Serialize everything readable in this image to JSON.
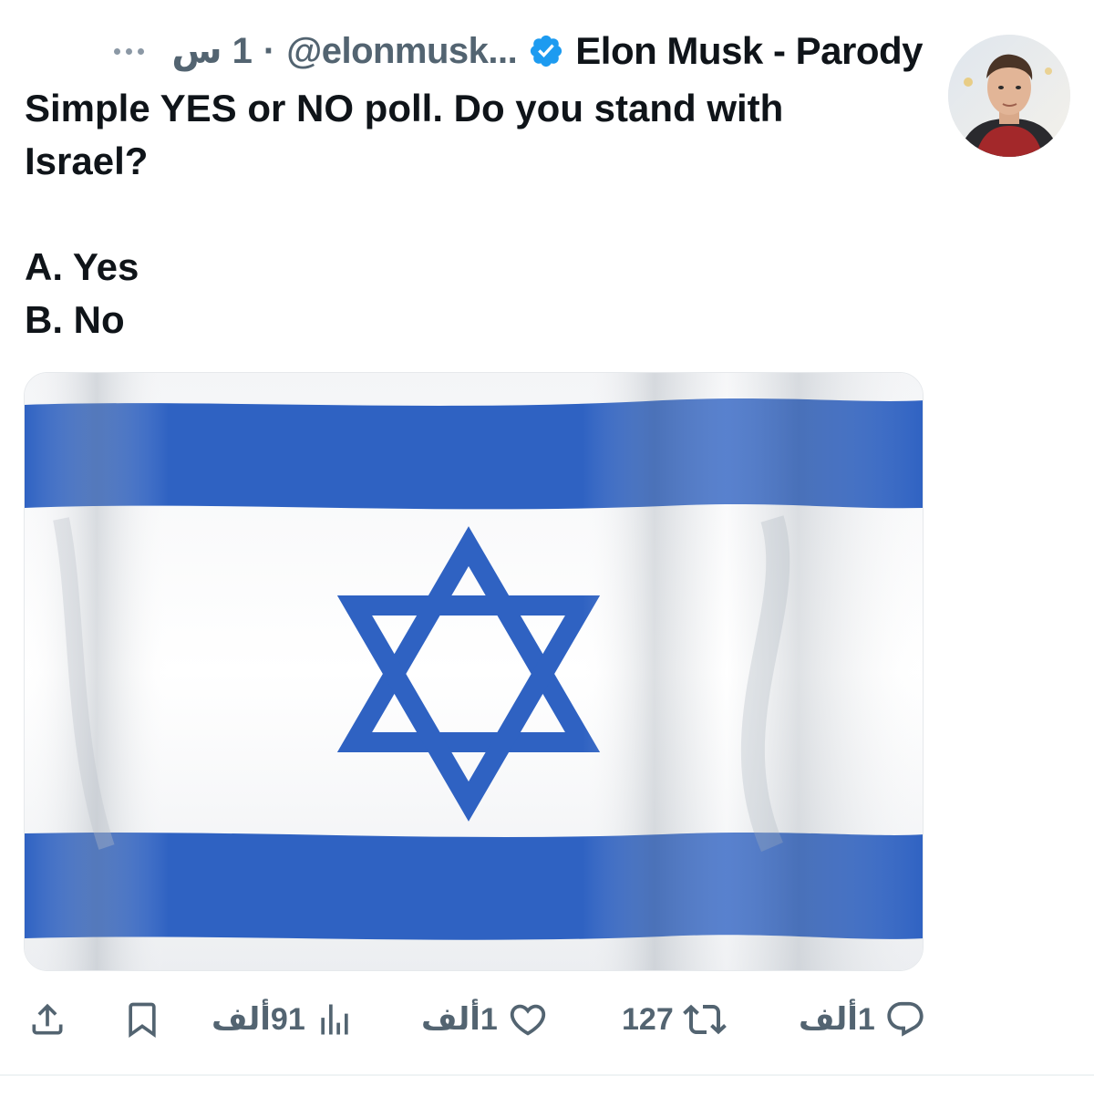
{
  "author": {
    "display_name": "Elon Musk - Parody",
    "handle": "@elonmusk...",
    "separator": "·",
    "time": "1 س",
    "verified": true,
    "verified_color": "#1d9bf0"
  },
  "tweet": {
    "line1": "Simple YES or NO poll. Do you stand with Israel?",
    "option_a": "A. Yes",
    "option_b": "B. No"
  },
  "media": {
    "description_icon": "israel-flag-image",
    "flag_blue": "#2f62c2"
  },
  "actions": {
    "replies": "1ألف",
    "reposts": "127",
    "likes": "1ألف",
    "views": "91ألف"
  },
  "colors": {
    "text_primary": "#0f1419",
    "text_secondary": "#536471"
  }
}
